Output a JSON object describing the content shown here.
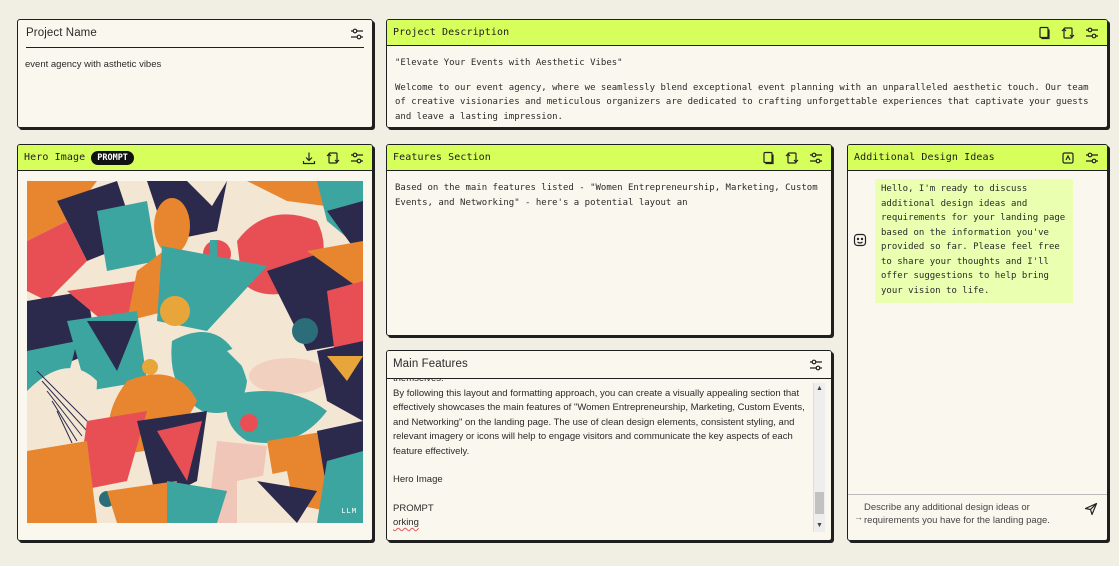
{
  "project_name": {
    "title": "Project Name",
    "value": "event agency with asthetic vibes"
  },
  "project_description": {
    "title": "Project Description",
    "headline": "\"Elevate Your Events with Aesthetic Vibes\"",
    "body": "Welcome to our event agency, where we seamlessly blend exceptional event planning with an unparalleled aesthetic touch. Our team of creative visionaries and meticulous organizers are dedicated to crafting unforgettable experiences that captivate your guests and leave a lasting impression."
  },
  "hero_image": {
    "title": "Hero Image",
    "badge": "PROMPT",
    "watermark": "LLM"
  },
  "features_section": {
    "title": "Features Section",
    "body": "Based on the main features listed - \"Women Entrepreneurship, Marketing, Custom Events, and Networking\" - here's a potential layout an"
  },
  "main_features": {
    "title": "Main Features",
    "top_cut": "themselves.",
    "paragraph": "By following this layout and formatting approach, you can create a visually appealing section that effectively showcases the main features of \"Women Entrepreneurship, Marketing, Custom Events, and Networking\" on the landing page. The use of clean design elements, consistent styling, and relevant imagery or icons will help to engage visitors and communicate the key aspects of each feature effectively.",
    "line_hero": "Hero Image",
    "line_prompt": "PROMPT",
    "line_orking": "orking"
  },
  "design_ideas": {
    "title": "Additional Design Ideas",
    "message": "Hello, I'm ready to discuss additional design ideas and requirements for your landing page based on the information you've provided so far. Please feel free to share your thoughts and I'll offer suggestions to help bring your vision to life.",
    "input_placeholder": "Describe any additional design ideas or requirements you have for the landing page."
  },
  "icons": {
    "settings": "sliders-icon",
    "copy": "copy-icon",
    "regenerate": "regenerate-icon",
    "download": "download-icon",
    "clear": "clear-chat-icon",
    "bot": "bot-icon",
    "send": "send-icon"
  },
  "colors": {
    "accent": "#d7ff5c",
    "bubble": "#eaffb0",
    "background": "#f1eee4"
  }
}
